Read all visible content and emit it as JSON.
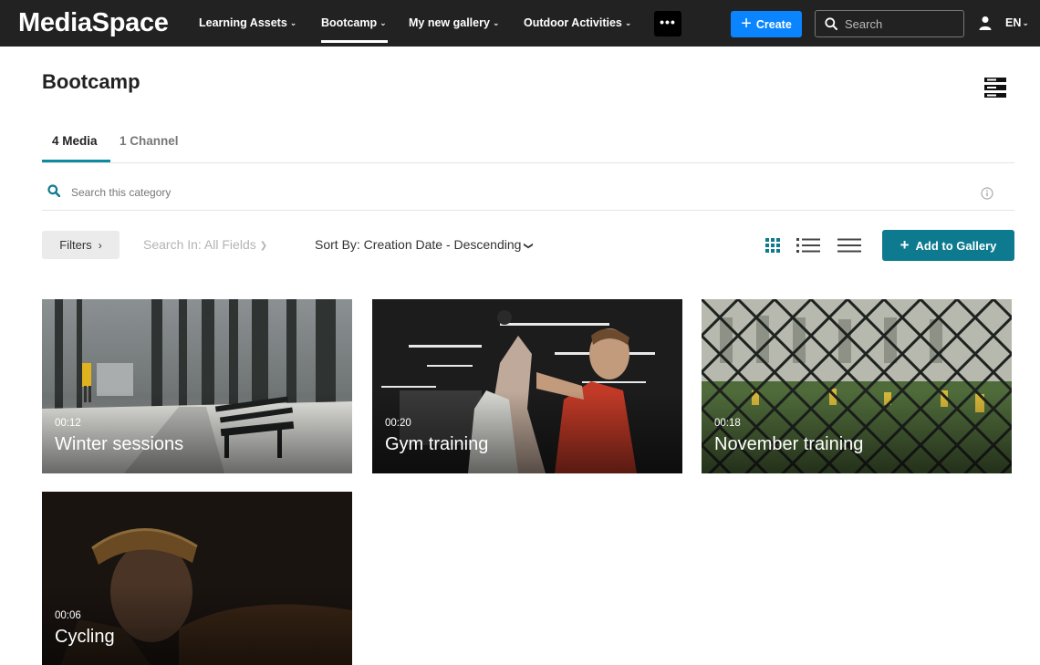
{
  "navbar": {
    "logo": "MediaSpace",
    "items": [
      {
        "label": "Learning Assets"
      },
      {
        "label": "Bootcamp"
      },
      {
        "label": "My new gallery"
      },
      {
        "label": "Outdoor Activities"
      }
    ],
    "more_label": "•••",
    "create_label": "Create",
    "search_placeholder": "Search",
    "language": "EN"
  },
  "page": {
    "title": "Bootcamp"
  },
  "tabs": [
    {
      "label": "4 Media"
    },
    {
      "label": "1 Channel"
    }
  ],
  "category_search": {
    "placeholder": "Search this category"
  },
  "toolbar": {
    "filters_label": "Filters",
    "search_in_label": "Search In: All Fields",
    "sort_by_label": "Sort By: Creation Date - Descending",
    "add_to_gallery_label": "Add to Gallery"
  },
  "colors": {
    "navbar_bg": "#222222",
    "create_button": "#0a84ff",
    "accent_teal": "#0e7a8f",
    "tab_underline": "#0e8ba0"
  },
  "media": [
    {
      "title": "Winter sessions",
      "duration": "00:12"
    },
    {
      "title": "Gym training",
      "duration": "00:20"
    },
    {
      "title": "November training",
      "duration": "00:18"
    },
    {
      "title": "Cycling",
      "duration": "00:06"
    }
  ]
}
